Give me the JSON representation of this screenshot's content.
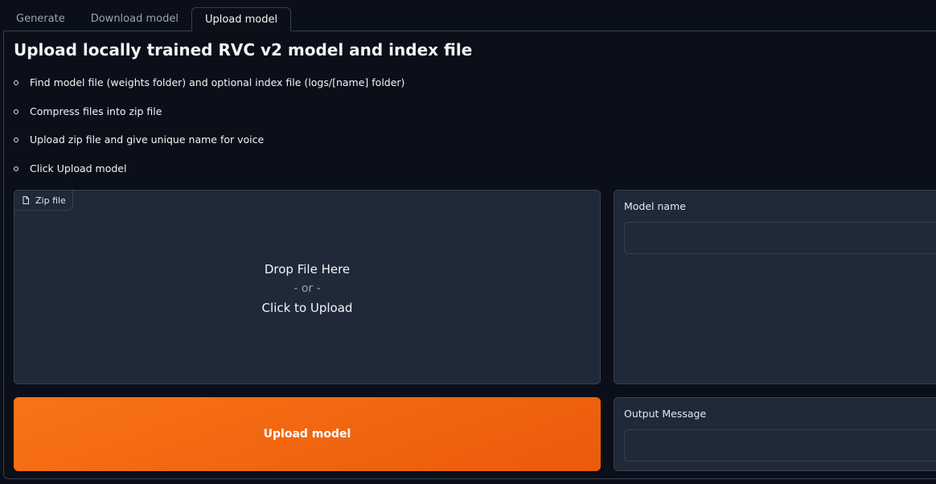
{
  "tabs": [
    {
      "label": "Generate",
      "active": false
    },
    {
      "label": "Download model",
      "active": false
    },
    {
      "label": "Upload model",
      "active": true
    }
  ],
  "title": "Upload locally trained RVC v2 model and index file",
  "steps": [
    "Find model file (weights folder) and optional index file (logs/[name] folder)",
    "Compress files into zip file",
    "Upload zip file and give unique name for voice",
    "Click Upload model"
  ],
  "zip_upload": {
    "label": "Zip file",
    "icon": "file-icon",
    "drop_text": "Drop File Here",
    "or_text": "- or -",
    "click_text": "Click to Upload"
  },
  "model_name": {
    "label": "Model name",
    "value": "",
    "placeholder": ""
  },
  "upload_button": {
    "label": "Upload model",
    "color": "#f97316"
  },
  "output_message": {
    "label": "Output Message",
    "value": "",
    "placeholder": ""
  },
  "colors": {
    "background": "#0b0f19",
    "panel": "#1f2937",
    "border": "#374151",
    "accent": "#f97316"
  }
}
